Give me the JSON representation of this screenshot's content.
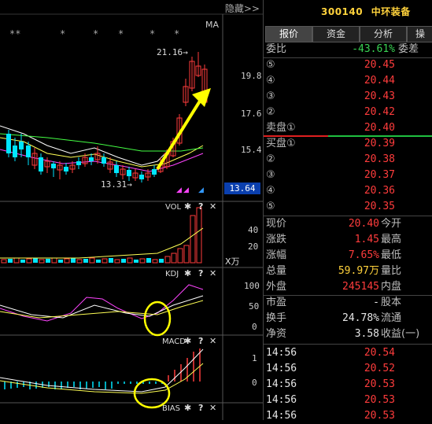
{
  "header": {
    "hide_label": "隐藏>>",
    "stock_code": "300140",
    "stock_name": "中环装备"
  },
  "tabs": [
    "报价",
    "资金",
    "分析",
    "操"
  ],
  "quote": {
    "weibi_label": "委比",
    "weibi_value": "-43.61%",
    "weicha_label": "委差",
    "sell_levels": [
      {
        "label": "⑤",
        "price": "20.45"
      },
      {
        "label": "④",
        "price": "20.44"
      },
      {
        "label": "③",
        "price": "20.43"
      },
      {
        "label": "②",
        "price": "20.42"
      },
      {
        "label": "卖盘①",
        "price": "20.40"
      }
    ],
    "buy_levels": [
      {
        "label": "买盘①",
        "price": "20.39"
      },
      {
        "label": "②",
        "price": "20.38"
      },
      {
        "label": "③",
        "price": "20.37"
      },
      {
        "label": "④",
        "price": "20.36"
      },
      {
        "label": "⑤",
        "price": "20.35"
      }
    ],
    "stats": [
      {
        "l1": "现价",
        "v": "20.40",
        "vcolor": "red",
        "l2": "今开"
      },
      {
        "l1": "涨跌",
        "v": "1.45",
        "vcolor": "red",
        "l2": "最高"
      },
      {
        "l1": "涨幅",
        "v": "7.65%",
        "vcolor": "red",
        "l2": "最低"
      },
      {
        "l1": "总量",
        "v": "59.97万",
        "vcolor": "yellow",
        "l2": "量比"
      },
      {
        "l1": "外盘",
        "v": "245145",
        "vcolor": "red",
        "l2": "内盘"
      }
    ],
    "stats2": [
      {
        "l1": "市盈",
        "v": "-",
        "vcolor": "white",
        "l2": "股本"
      },
      {
        "l1": "换手",
        "v": "24.78%",
        "vcolor": "white",
        "l2": "流通"
      },
      {
        "l1": "净资",
        "v": "3.58",
        "vcolor": "white",
        "l2": "收益(一)"
      }
    ],
    "ticks": [
      {
        "time": "14:56",
        "price": "20.54"
      },
      {
        "time": "14:56",
        "price": "20.52"
      },
      {
        "time": "14:56",
        "price": "20.53"
      },
      {
        "time": "14:56",
        "price": "20.53"
      },
      {
        "time": "14:56",
        "price": "20.53"
      }
    ]
  },
  "chart": {
    "ma_label": "MA",
    "high_label": "21.16",
    "low_label": "13.31",
    "price_axis": [
      "19.8",
      "17.6",
      "15.4"
    ],
    "current_price": "13.64",
    "stars": [
      "**",
      "*",
      "*",
      "*",
      "*",
      "*"
    ],
    "vol_label": "VOL",
    "vol_axis": [
      "40",
      "20"
    ],
    "vol_unit": "X万",
    "kdj_label": "KDJ",
    "kdj_axis": [
      "100",
      "50",
      "0"
    ],
    "macd_label": "MACD",
    "macd_axis": [
      "1",
      "0"
    ],
    "bias_label": "BIAS",
    "panel_icons": [
      "gear-icon",
      "help-icon",
      "close-icon"
    ],
    "icon_glyphs": {
      "gear": "✱",
      "help": "?",
      "close": "✕"
    }
  },
  "colors": {
    "up": "#ff3c3c",
    "down": "#00e5ff",
    "ma_yellow": "#ffff55",
    "ma_magenta": "#ff44ff",
    "ma_green": "#44ff44",
    "ma_white": "#ffffff",
    "arrow": "#ffff00"
  }
}
